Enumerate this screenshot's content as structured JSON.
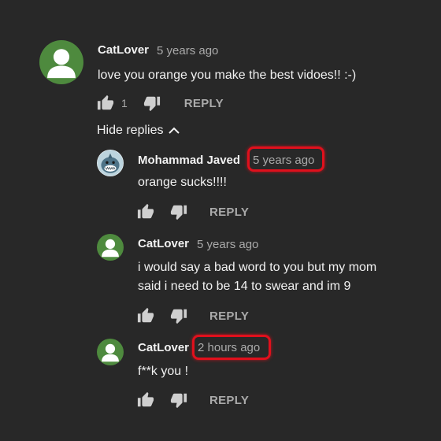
{
  "colors": {
    "background": "#282828",
    "avatar_green": "#4e8a3e",
    "highlight_red": "#e0101c"
  },
  "comment_top": {
    "author": "CatLover",
    "time": "5 years ago",
    "text": "love you orange you make the best vidoes!! :-)",
    "like_count": "1",
    "reply_label": "REPLY"
  },
  "hide_replies_label": "Hide replies",
  "replies": [
    {
      "author": "Mohammad Javed",
      "time": "5 years ago",
      "text_lines": [
        "orange sucks!!!!"
      ],
      "reply_label": "REPLY",
      "time_highlighted": true
    },
    {
      "author": "CatLover",
      "time": "5 years ago",
      "text_lines": [
        "i would say a bad word to you but my mom",
        "said i need to be 14 to swear and im 9"
      ],
      "reply_label": "REPLY",
      "time_highlighted": false
    },
    {
      "author": "CatLover",
      "time": "2 hours ago",
      "text_lines": [
        "f**k you !"
      ],
      "reply_label": "REPLY",
      "time_highlighted": true
    }
  ],
  "icons": {
    "like": "thumbs-up-icon",
    "dislike": "thumbs-down-icon",
    "chevron": "chevron-up-icon",
    "avatar_default": "default-avatar-icon",
    "avatar_shark": "shark-avatar-icon"
  }
}
